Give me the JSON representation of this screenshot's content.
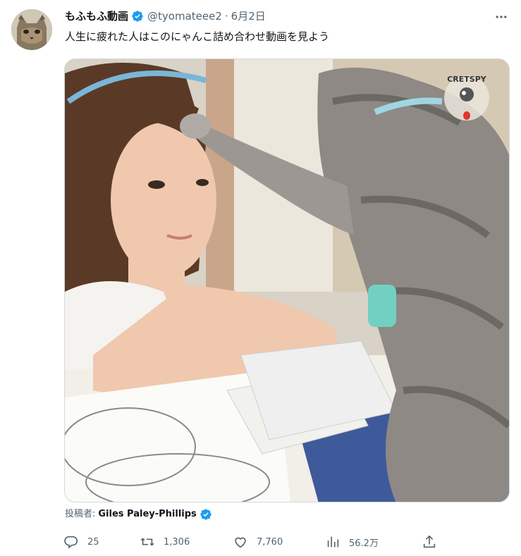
{
  "tweet": {
    "author_name": "もふもふ動画",
    "handle": "@tyomateee2",
    "separator": "·",
    "date": "6月2日",
    "more_label": "···",
    "text": "人生に疲れた人はこのにゃんこ詰め合わせ動画を見よう"
  },
  "media": {
    "description": "video-frame",
    "watermark_text": "CRETSPY"
  },
  "credit": {
    "prefix": "投稿者:",
    "author": "Giles Paley-Phillips"
  },
  "actions": {
    "replies": "25",
    "retweets": "1,306",
    "likes": "7,760",
    "views": "56.2万"
  },
  "colors": {
    "verified": "#1d9bf0",
    "secondary_text": "#536471",
    "primary_text": "#0f1419"
  }
}
